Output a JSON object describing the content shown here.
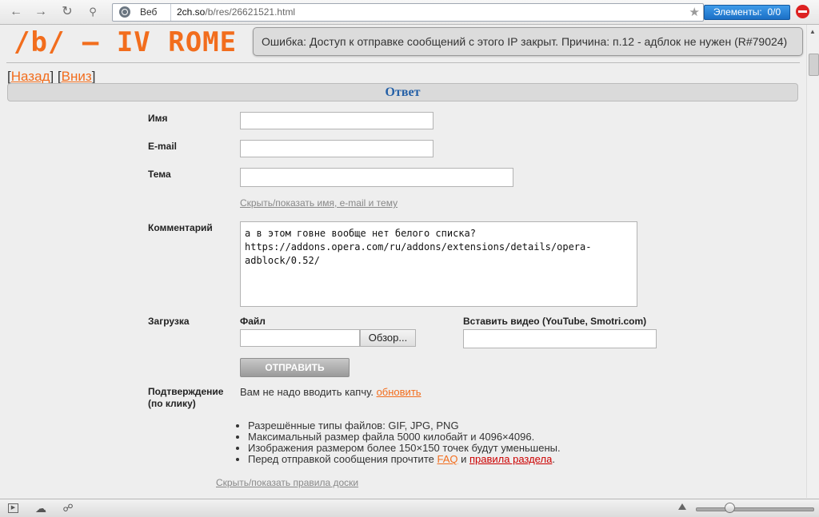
{
  "browser": {
    "scheme_label": "Веб",
    "url_host": "2ch.so",
    "url_path": "/b/res/26621521.html",
    "elements_label": "Элементы:",
    "elements_count": "0/0"
  },
  "board": {
    "title": "/b/ – IV ROME",
    "error_message": "Ошибка: Доступ к отправке сообщений с этого IP закрыт. Причина: п.12 - адблок не нужен (R#79024)"
  },
  "nav": {
    "open_bracket": "[",
    "close_bracket": "]",
    "back": "Назад",
    "down": "Вниз"
  },
  "form": {
    "header": "Ответ",
    "name_label": "Имя",
    "email_label": "E-mail",
    "subject_label": "Тема",
    "toggle_fields": "Скрыть/показать имя, e-mail и тему",
    "comment_label": "Комментарий",
    "comment_value": "а в этом говне вообще нет белого списка?\nhttps://addons.opera.com/ru/addons/extensions/details/opera-adblock/0.52/",
    "upload_label": "Загрузка",
    "file_label": "Файл",
    "browse_button": "Обзор...",
    "video_label": "Вставить видео (YouTube, Smotri.com)",
    "submit_button": "ОТПРАВИТЬ",
    "confirm_label_1": "Подтверждение",
    "confirm_label_2": "(по клику)",
    "captcha_text": "Вам не надо вводить капчу.",
    "captcha_refresh": "обновить"
  },
  "rules": {
    "items": [
      "Разрешённые типы файлов: GIF, JPG, PNG",
      "Максимальный размер файла 5000 килобайт и 4096×4096.",
      "Изображения размером более 150×150 точек будут уменьшены."
    ],
    "last_prefix": "Перед отправкой сообщения прочтите",
    "faq_link": "FAQ",
    "and_word": "и",
    "rules_link": "правила раздела",
    "last_suffix": ".",
    "toggle_rules": "Скрыть/показать правила доски"
  },
  "colors": {
    "accent_orange": "#f26d1d",
    "header_blue": "#2460a7",
    "rules_red": "#cc0000"
  }
}
